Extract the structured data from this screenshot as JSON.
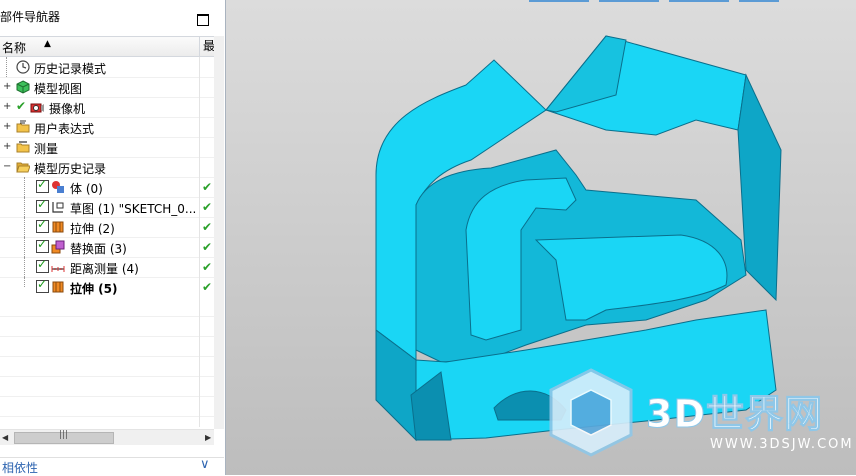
{
  "navigator": {
    "title": "部件导航器",
    "columns": {
      "name": "名称",
      "latest": "最"
    },
    "items": [
      {
        "label": "历史记录模式",
        "icon": "clock-icon",
        "level": 0,
        "expander": false,
        "checkbox": false,
        "bold": false,
        "latest": false
      },
      {
        "label": "模型视图",
        "icon": "cube-view-icon",
        "level": 0,
        "expander": true,
        "checkbox": false,
        "bold": false,
        "latest": false
      },
      {
        "label": "摄像机",
        "icon": "camera-icon",
        "level": 0,
        "expander": true,
        "checkbox": false,
        "green_check": true,
        "bold": false,
        "latest": false
      },
      {
        "label": "用户表达式",
        "icon": "folder-expression-icon",
        "level": 0,
        "expander": true,
        "checkbox": false,
        "bold": false,
        "latest": false
      },
      {
        "label": "测量",
        "icon": "folder-measure-icon",
        "level": 0,
        "expander": true,
        "checkbox": false,
        "bold": false,
        "latest": false
      },
      {
        "label": "模型历史记录",
        "icon": "folder-open-icon",
        "level": 0,
        "expander": true,
        "expanded": true,
        "checkbox": false,
        "bold": false,
        "latest": false
      },
      {
        "label": "体 (0)",
        "icon": "body-icon",
        "level": 1,
        "checkbox": true,
        "bold": false,
        "latest": true
      },
      {
        "label": "草图 (1) \"SKETCH_0...",
        "icon": "sketch-icon",
        "level": 1,
        "checkbox": true,
        "bold": false,
        "latest": true
      },
      {
        "label": "拉伸 (2)",
        "icon": "extrude-icon",
        "level": 1,
        "checkbox": true,
        "bold": false,
        "latest": true
      },
      {
        "label": "替换面 (3)",
        "icon": "replace-face-icon",
        "level": 1,
        "checkbox": true,
        "bold": false,
        "latest": true
      },
      {
        "label": "距离测量 (4)",
        "icon": "distance-measure-icon",
        "level": 1,
        "checkbox": true,
        "bold": false,
        "latest": true
      },
      {
        "label": "拉伸 (5)",
        "icon": "extrude-icon",
        "level": 1,
        "checkbox": true,
        "bold": true,
        "latest": true
      }
    ],
    "dependencies_label": "相依性"
  },
  "watermark": {
    "text": "3D世界网",
    "url": "WWW.3DSJW.COM"
  },
  "colors": {
    "model": "#1ad6f5",
    "model_shadow": "#0b8fb0",
    "model_dark": "#0a6f8c",
    "viewport_top": "#dcdcdc",
    "viewport_bottom": "#bdbdbd",
    "link_blue": "#2d64b0",
    "check_green": "#2aa02a"
  }
}
